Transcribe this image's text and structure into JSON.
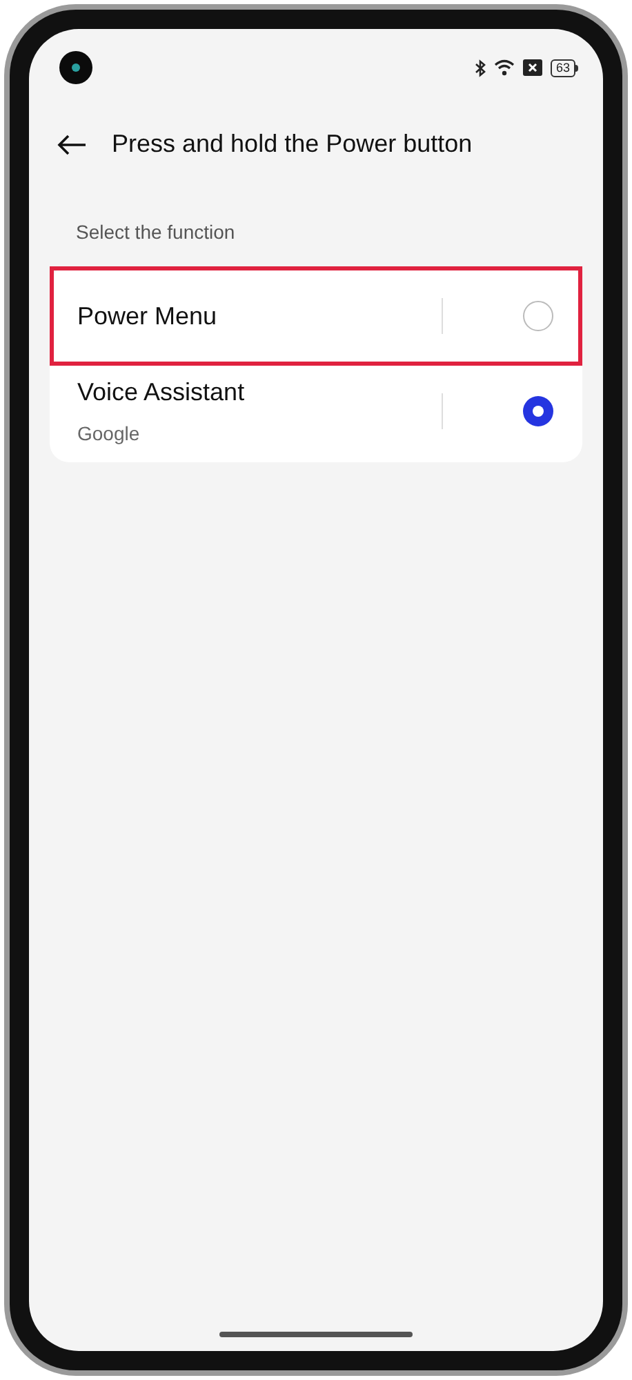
{
  "status_bar": {
    "battery": "63"
  },
  "header": {
    "title": "Press and hold the Power button"
  },
  "section": {
    "label": "Select the function"
  },
  "options": [
    {
      "title": "Power Menu",
      "selected": false,
      "highlighted": true
    },
    {
      "title": "Voice Assistant",
      "subtitle": "Google",
      "selected": true,
      "highlighted": false
    }
  ]
}
